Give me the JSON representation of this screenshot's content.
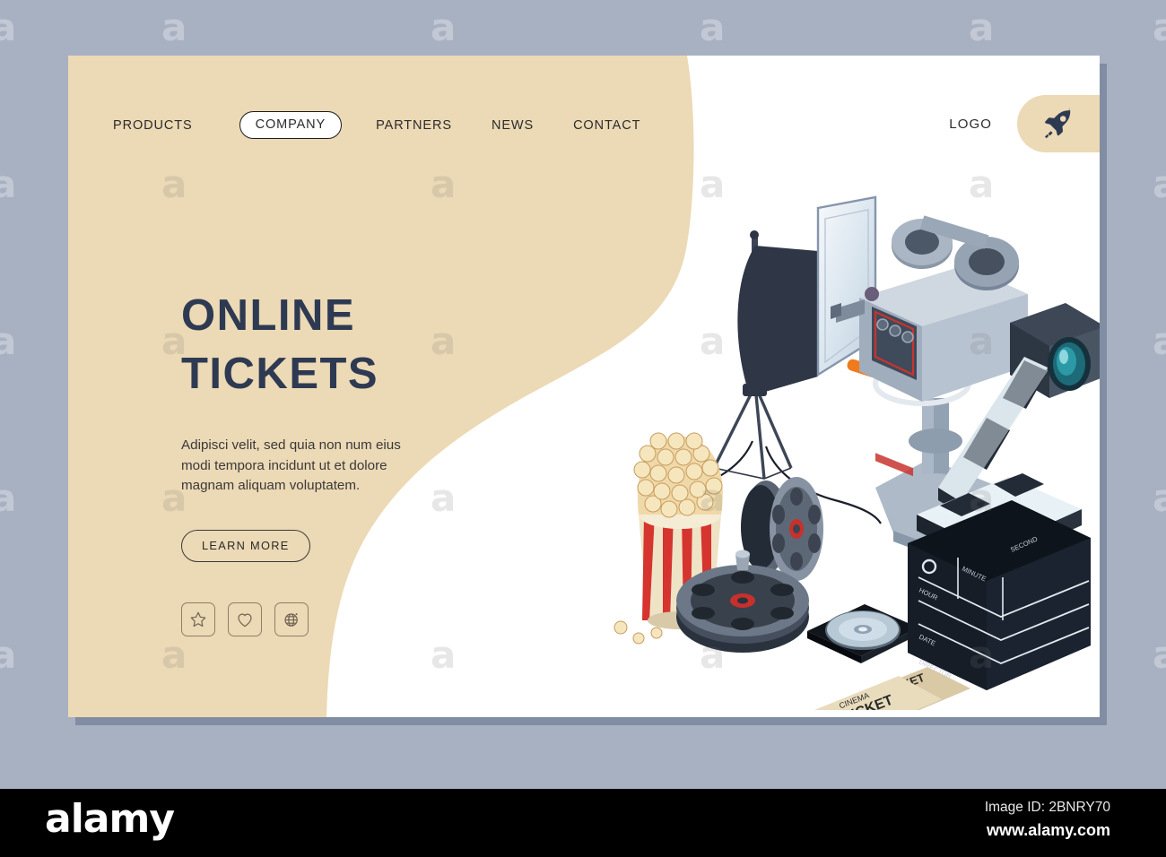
{
  "page": {
    "background_color": "#a8b1c2",
    "card_background": "#ffffff",
    "blob_color": "#ecd9b5",
    "heading_color": "#2e3a52"
  },
  "nav": {
    "items": [
      {
        "label": "PRODUCTS",
        "active": false
      },
      {
        "label": "COMPANY",
        "active": true
      },
      {
        "label": "PARTNERS",
        "active": false
      },
      {
        "label": "NEWS",
        "active": false
      },
      {
        "label": "CONTACT",
        "active": false
      }
    ],
    "logo_text": "LOGO",
    "logo_icon": "rocket-icon"
  },
  "hero": {
    "title_line1": "ONLINE",
    "title_line2": "TICKETS",
    "paragraph": "Adipisci velit, sed quia non num eius modi tempora incidunt ut et dolore magnam aliquam voluptatem.",
    "cta_label": "LEARN MORE",
    "social_icons": [
      {
        "name": "star-icon"
      },
      {
        "name": "heart-icon"
      },
      {
        "name": "globe-icon"
      }
    ]
  },
  "illustration": {
    "description": "Isometric cinema equipment scene",
    "objects": [
      "softbox-light",
      "movie-camera",
      "popcorn-bucket",
      "film-reel-standing",
      "film-reel-lying",
      "cd-case",
      "cinema-tickets",
      "clapperboard"
    ],
    "clapperboard_labels": {
      "hour": "HOUR",
      "minute": "MINUTE",
      "second": "SECOND",
      "date": "DATE",
      "director": "DIRECTOR"
    },
    "ticket_text_line1": "CINEMA",
    "ticket_text_line2": "TICKET"
  },
  "watermark": {
    "tile_letter": "a",
    "footer_brand": "alamy",
    "image_id": "Image ID: 2BNRY70",
    "url": "www.alamy.com"
  }
}
